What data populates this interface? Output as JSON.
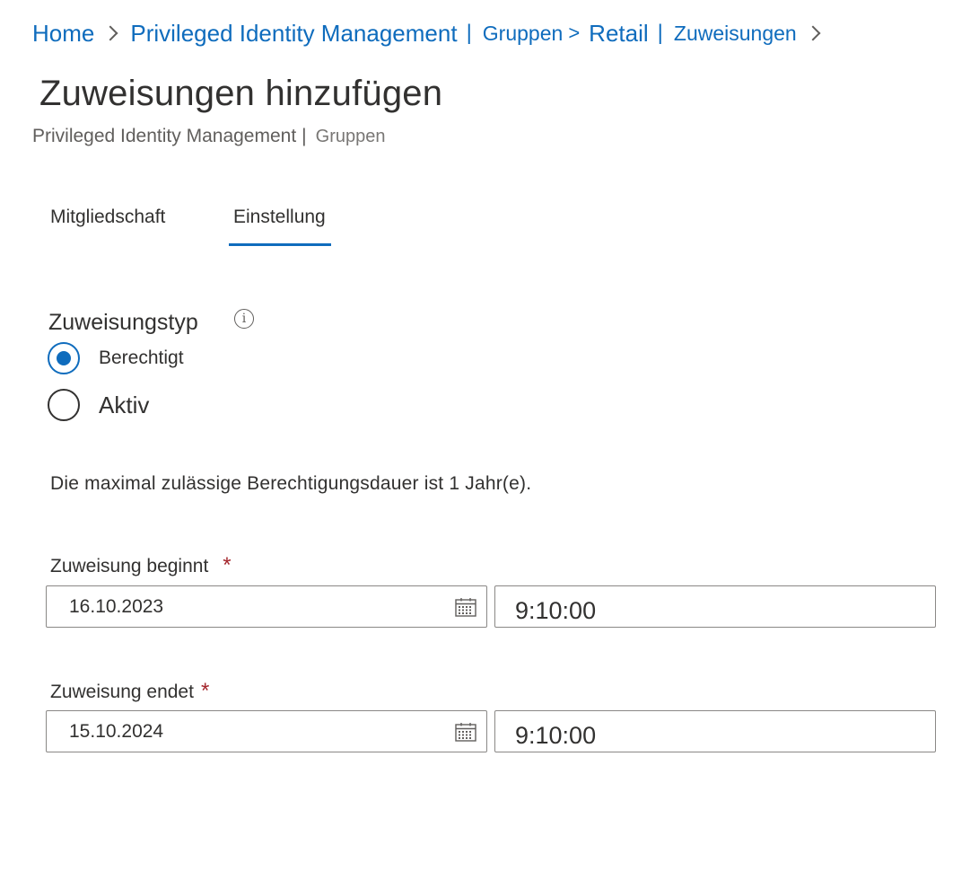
{
  "breadcrumb": {
    "home": "Home",
    "pim": "Privileged Identity Management",
    "pipe1": "|",
    "groups": "Gruppen",
    "gt": ">",
    "retail": "Retail",
    "pipe2": "|",
    "assignments": "Zuweisungen"
  },
  "page": {
    "title": "Zuweisungen hinzufügen",
    "subtitle_main": "Privileged Identity Management",
    "subtitle_pipe": "|",
    "subtitle_second": "Gruppen"
  },
  "tabs": [
    {
      "label": "Mitgliedschaft",
      "active": false
    },
    {
      "label": "Einstellung",
      "active": true
    }
  ],
  "assignment_type": {
    "label": "Zuweisungstyp",
    "info_icon": "info-icon",
    "options": [
      {
        "label": "Berechtigt",
        "checked": true
      },
      {
        "label": "Aktiv",
        "checked": false
      }
    ]
  },
  "max_duration_text": "Die maximal zulässige Berechtigungsdauer ist 1 Jahr(e).",
  "start": {
    "label": "Zuweisung beginnt",
    "required_mark": "*",
    "date": "16.10.2023",
    "time": "9:10:00"
  },
  "end": {
    "label": "Zuweisung endet",
    "required_mark": "*",
    "date": "15.10.2024",
    "time": "9:10:00"
  },
  "colors": {
    "accent": "#0f6cbd",
    "text": "#323130",
    "secondary_text": "#605e5c",
    "required": "#a4262c",
    "input_border": "#8a8886"
  },
  "icons": {
    "breadcrumb_separator": "chevron-right-icon",
    "date_picker": "calendar-icon"
  }
}
